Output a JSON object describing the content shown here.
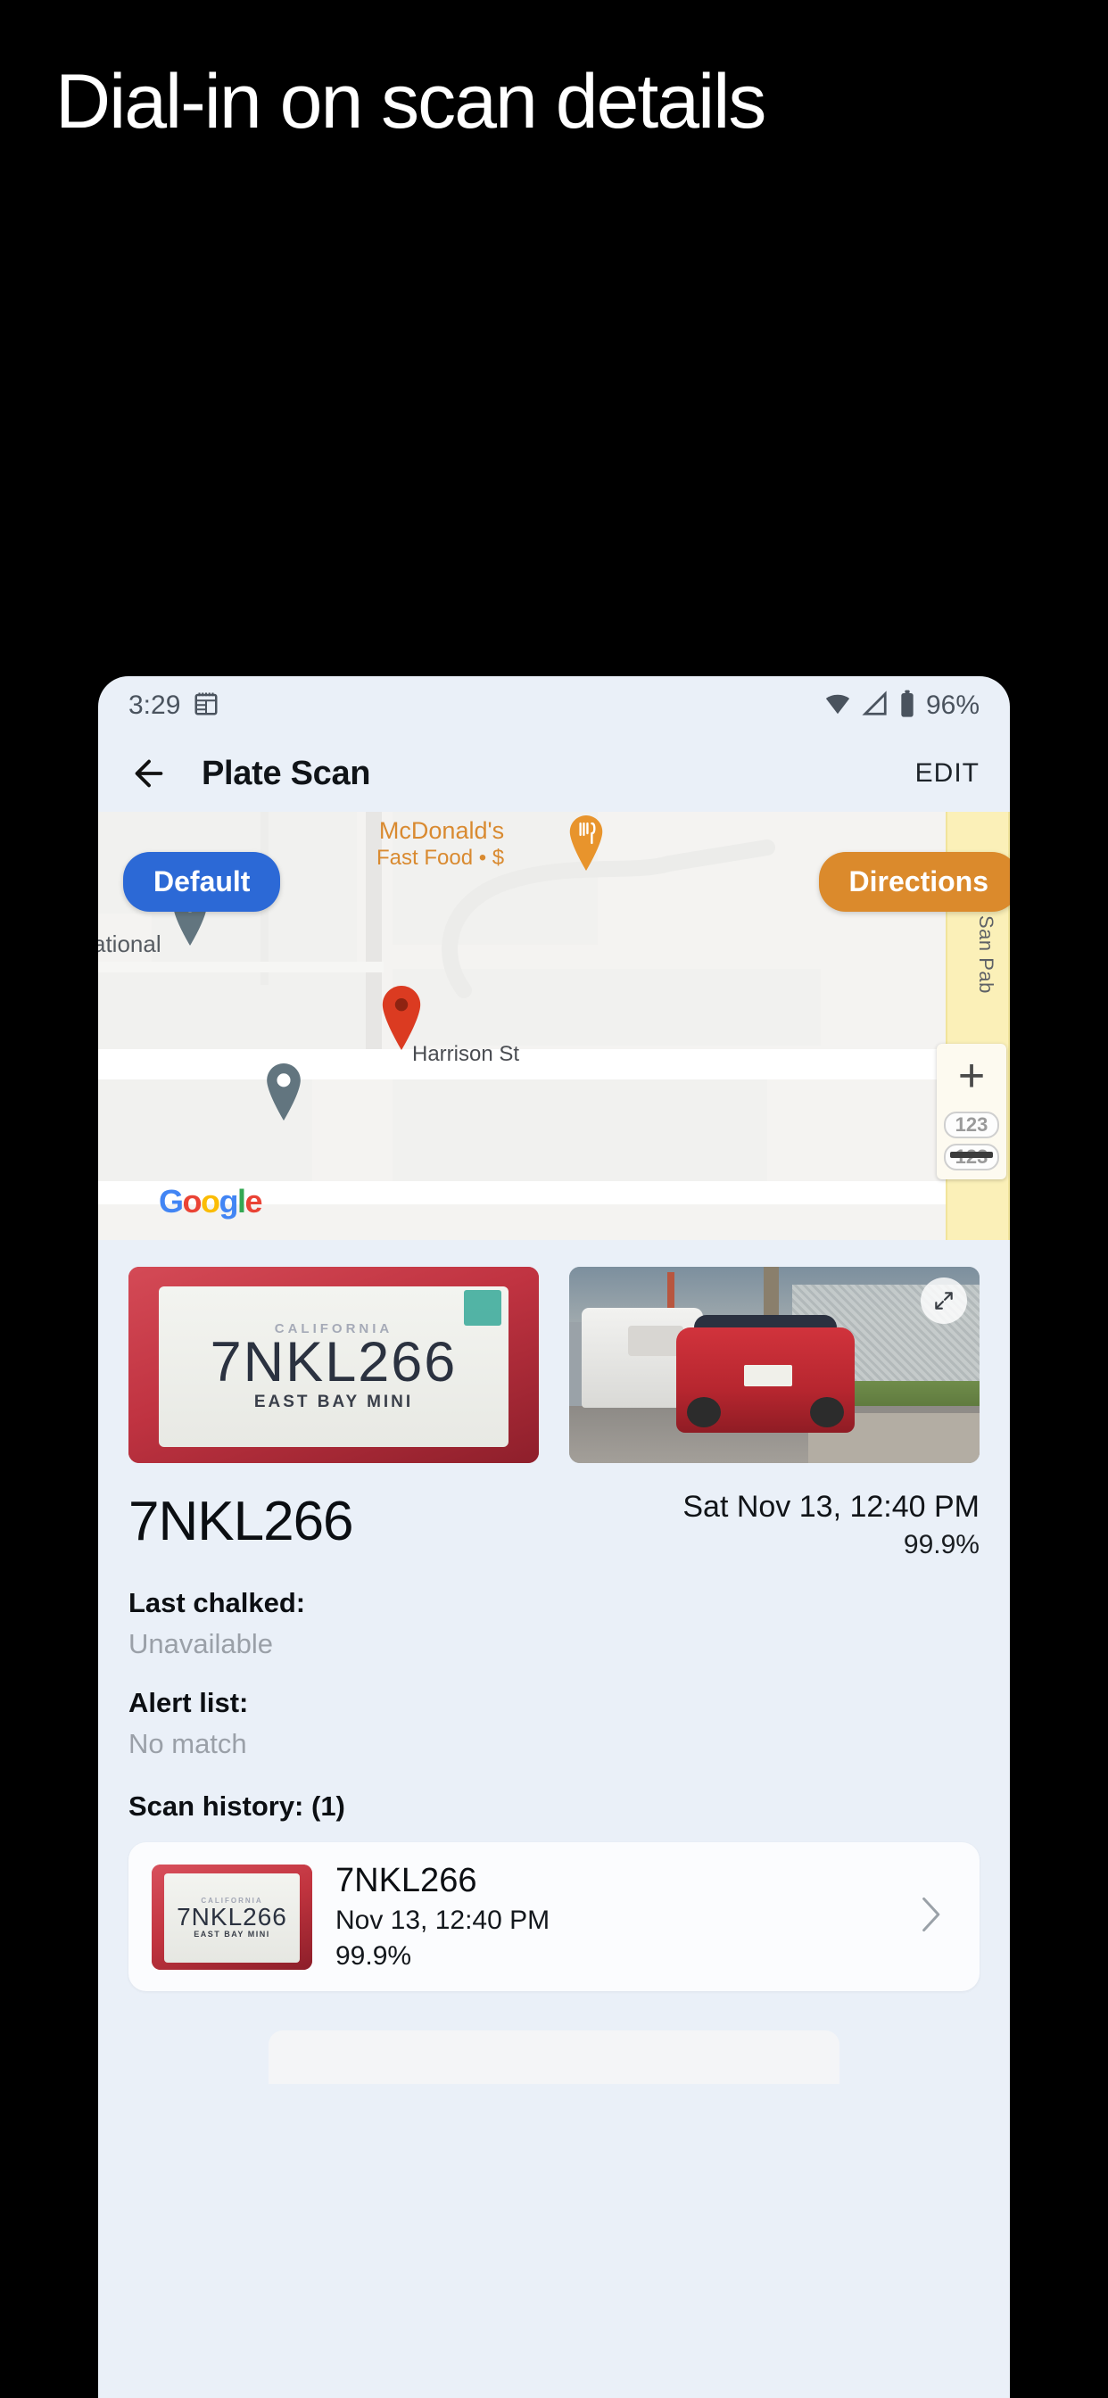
{
  "promo": {
    "headline": "Dial-in on scan details"
  },
  "status_bar": {
    "time": "3:29",
    "calendar_icon": "calendar-icon",
    "wifi_icon": "wifi-icon",
    "signal_icon": "signal-icon",
    "battery_icon": "battery-icon",
    "battery_percent": "96%"
  },
  "app_bar": {
    "back_icon": "back-arrow-icon",
    "title": "Plate Scan",
    "edit_label": "EDIT"
  },
  "map": {
    "default_button": "Default",
    "directions_button": "Directions",
    "poi_name": "McDonald's",
    "poi_sub": "Fast Food • $",
    "street_label": "Harrison St",
    "street_vertical": "San Pab",
    "partial_label": "ational",
    "attribution": "Google",
    "zoom_in": "+",
    "shield_1": "123",
    "shield_2": "123",
    "colors": {
      "default_btn": "#2C69D6",
      "directions_btn": "#DB8A2C",
      "pin_red": "#DB3B21",
      "pin_gray": "#62757F",
      "highway_yellow": "#FBF0B8"
    }
  },
  "scan": {
    "plate_thumb": {
      "top_text": "CALIFORNIA",
      "number": "7NKL266",
      "bottom_text": "EAST BAY MINI"
    },
    "photo_expand_icon": "expand-icon",
    "plate_number": "7NKL266",
    "timestamp": "Sat Nov 13, 12:40 PM",
    "confidence": "99.9%"
  },
  "fields": [
    {
      "label": "Last chalked:",
      "value": "Unavailable"
    },
    {
      "label": "Alert list:",
      "value": "No match"
    }
  ],
  "scan_history": {
    "section_label": "Scan history: (1)",
    "items": [
      {
        "thumb_top": "CALIFORNIA",
        "thumb_number": "7NKL266",
        "thumb_bottom": "EAST BAY MINI",
        "plate": "7NKL266",
        "date": "Nov 13, 12:40 PM",
        "confidence": "99.9%",
        "chevron_icon": "chevron-right-icon"
      }
    ]
  }
}
